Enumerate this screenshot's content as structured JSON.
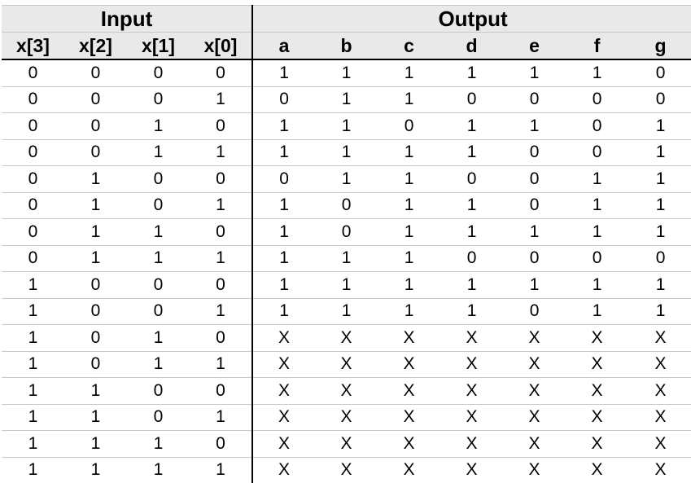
{
  "table": {
    "input_header": "Input",
    "output_header": "Output",
    "input_columns": [
      "x[3]",
      "x[2]",
      "x[1]",
      "x[0]"
    ],
    "output_columns": [
      "a",
      "b",
      "c",
      "d",
      "e",
      "f",
      "g"
    ],
    "rows": [
      [
        "0",
        "0",
        "0",
        "0",
        "1",
        "1",
        "1",
        "1",
        "1",
        "1",
        "0"
      ],
      [
        "0",
        "0",
        "0",
        "1",
        "0",
        "1",
        "1",
        "0",
        "0",
        "0",
        "0"
      ],
      [
        "0",
        "0",
        "1",
        "0",
        "1",
        "1",
        "0",
        "1",
        "1",
        "0",
        "1"
      ],
      [
        "0",
        "0",
        "1",
        "1",
        "1",
        "1",
        "1",
        "1",
        "0",
        "0",
        "1"
      ],
      [
        "0",
        "1",
        "0",
        "0",
        "0",
        "1",
        "1",
        "0",
        "0",
        "1",
        "1"
      ],
      [
        "0",
        "1",
        "0",
        "1",
        "1",
        "0",
        "1",
        "1",
        "0",
        "1",
        "1"
      ],
      [
        "0",
        "1",
        "1",
        "0",
        "1",
        "0",
        "1",
        "1",
        "1",
        "1",
        "1"
      ],
      [
        "0",
        "1",
        "1",
        "1",
        "1",
        "1",
        "1",
        "0",
        "0",
        "0",
        "0"
      ],
      [
        "1",
        "0",
        "0",
        "0",
        "1",
        "1",
        "1",
        "1",
        "1",
        "1",
        "1"
      ],
      [
        "1",
        "0",
        "0",
        "1",
        "1",
        "1",
        "1",
        "1",
        "0",
        "1",
        "1"
      ],
      [
        "1",
        "0",
        "1",
        "0",
        "X",
        "X",
        "X",
        "X",
        "X",
        "X",
        "X"
      ],
      [
        "1",
        "0",
        "1",
        "1",
        "X",
        "X",
        "X",
        "X",
        "X",
        "X",
        "X"
      ],
      [
        "1",
        "1",
        "0",
        "0",
        "X",
        "X",
        "X",
        "X",
        "X",
        "X",
        "X"
      ],
      [
        "1",
        "1",
        "0",
        "1",
        "X",
        "X",
        "X",
        "X",
        "X",
        "X",
        "X"
      ],
      [
        "1",
        "1",
        "1",
        "0",
        "X",
        "X",
        "X",
        "X",
        "X",
        "X",
        "X"
      ],
      [
        "1",
        "1",
        "1",
        "1",
        "X",
        "X",
        "X",
        "X",
        "X",
        "X",
        "X"
      ]
    ]
  }
}
